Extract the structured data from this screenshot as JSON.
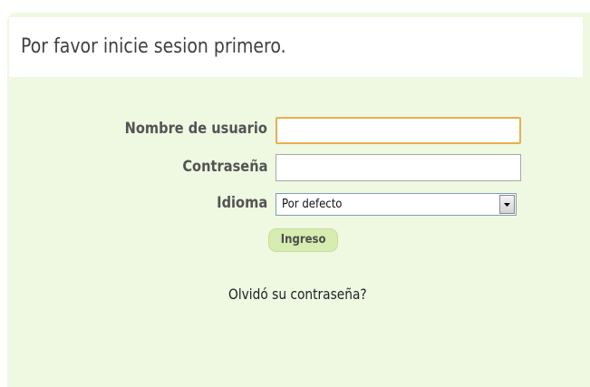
{
  "header": {
    "title": "Por favor inicie sesion primero."
  },
  "form": {
    "username_label": "Nombre de usuario",
    "username_value": "",
    "password_label": "Contraseña",
    "password_value": "",
    "language_label": "Idioma",
    "language_selected": "Por defecto",
    "submit_label": "Ingreso",
    "forgot_password_label": "Olvidó su contraseña?"
  },
  "colors": {
    "panel_background": "#eff8e1",
    "button_background": "#d7ecb0",
    "focused_input_border": "#e6b04f"
  },
  "icons": {
    "select_arrow": "chevron-down-icon"
  }
}
